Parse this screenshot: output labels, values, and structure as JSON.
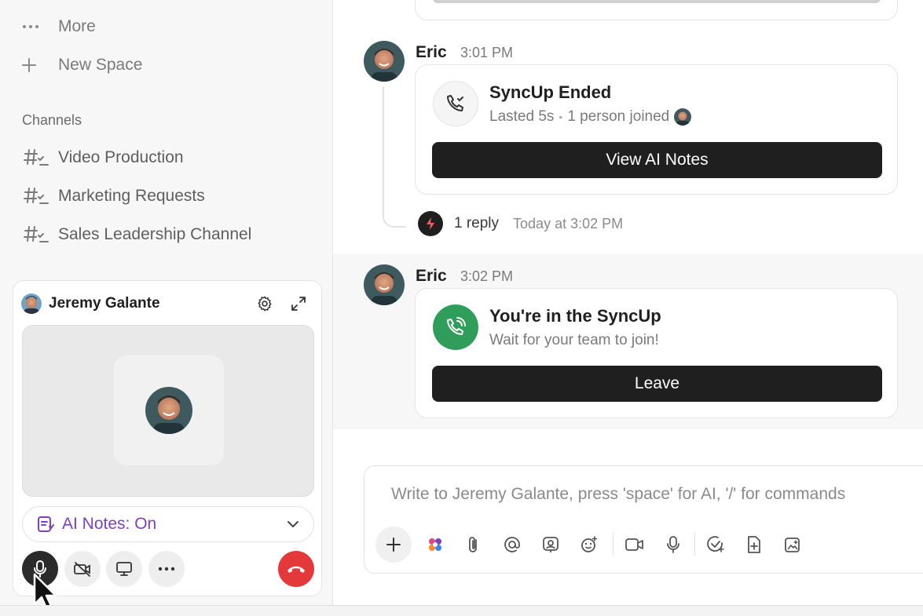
{
  "sidebar": {
    "more_label": "More",
    "new_space_label": "New Space",
    "channels_heading": "Channels",
    "channels": [
      {
        "label": "Video Production"
      },
      {
        "label": "Marketing Requests"
      },
      {
        "label": "Sales Leadership Channel"
      }
    ]
  },
  "call": {
    "participant_name": "Jeremy Galante",
    "ai_notes_label": "AI Notes: On",
    "colors": {
      "ai_notes": "#7b3fbf",
      "end_call": "#e5383b",
      "mic_active": "#2b2b2b"
    }
  },
  "messages": [
    {
      "author": "Eric",
      "time": "3:01 PM",
      "card": {
        "title": "SyncUp Ended",
        "lasted": "Lasted 5s",
        "separator": "•",
        "joined": "1 person joined",
        "button": "View AI Notes",
        "icon": "phone-check-icon"
      },
      "thread": {
        "reply_count": "1 reply",
        "reply_time": "Today at 3:02 PM"
      }
    },
    {
      "author": "Eric",
      "time": "3:02 PM",
      "card": {
        "title": "You're in the SyncUp",
        "subtitle": "Wait for your team to join!",
        "button": "Leave",
        "icon": "phone-ringing-icon",
        "icon_color": "#2f9e5a"
      }
    }
  ],
  "composer": {
    "placeholder": "Write to Jeremy Galante, press 'space' for AI, '/' for commands",
    "tools": [
      "plus-icon",
      "ai-sparkle-icon",
      "paperclip-icon",
      "mention-icon",
      "assign-icon",
      "emoji-icon",
      "video-clip-icon",
      "microphone-icon",
      "task-icon",
      "doc-icon",
      "image-ai-icon"
    ]
  }
}
